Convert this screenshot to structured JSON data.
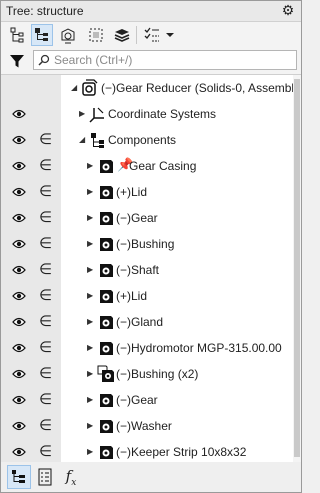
{
  "window": {
    "title": "Tree: structure",
    "settings_icon": "gear-icon"
  },
  "toolbar": {
    "buttons": [
      {
        "name": "tree-view-icon",
        "active": false
      },
      {
        "name": "structure-view-icon",
        "active": true
      },
      {
        "name": "scene-objects-icon",
        "active": false
      },
      {
        "name": "selection-box-icon",
        "active": false
      },
      {
        "name": "layers-icon",
        "active": false
      },
      {
        "name": "checklist-icon",
        "active": false
      },
      {
        "name": "dropdown-arrow-icon",
        "active": false
      }
    ]
  },
  "search": {
    "placeholder": "Search (Ctrl+/)",
    "value": ""
  },
  "tree": {
    "root": {
      "label": "(−)Gear Reducer (Solids-0, Assembly unit)",
      "expanded": true
    },
    "coordinate_systems": {
      "label": "Coordinate Systems",
      "expanded": false
    },
    "components": {
      "label": "Components",
      "expanded": true
    },
    "items": [
      {
        "label": "Gear Casing",
        "fixed": true,
        "icon": "part-icon"
      },
      {
        "label": "(+)Lid",
        "fixed": false,
        "icon": "part-icon"
      },
      {
        "label": "(−)Gear",
        "fixed": false,
        "icon": "part-icon"
      },
      {
        "label": "(−)Bushing",
        "fixed": false,
        "icon": "part-icon"
      },
      {
        "label": "(−)Shaft",
        "fixed": false,
        "icon": "part-icon"
      },
      {
        "label": "(+)Lid",
        "fixed": false,
        "icon": "part-icon"
      },
      {
        "label": "(−)Gland",
        "fixed": false,
        "icon": "part-icon"
      },
      {
        "label": "(−)Hydromotor MGP-315.00.00",
        "fixed": false,
        "icon": "part-icon"
      },
      {
        "label": "(−)Bushing (x2)",
        "fixed": false,
        "icon": "multi-part-icon"
      },
      {
        "label": "(−)Gear",
        "fixed": false,
        "icon": "part-icon"
      },
      {
        "label": "(−)Washer",
        "fixed": false,
        "icon": "part-icon"
      },
      {
        "label": "(−)Keeper Strip 10x8x32",
        "fixed": false,
        "icon": "part-icon"
      }
    ]
  },
  "bottom_tabs": {
    "fx_label": "f",
    "fx_sub": "x"
  },
  "colors": {
    "accent_active_bg": "#d7e7f7",
    "accent_active_border": "#9cc3e9",
    "gutter": "#e8e8e8"
  }
}
